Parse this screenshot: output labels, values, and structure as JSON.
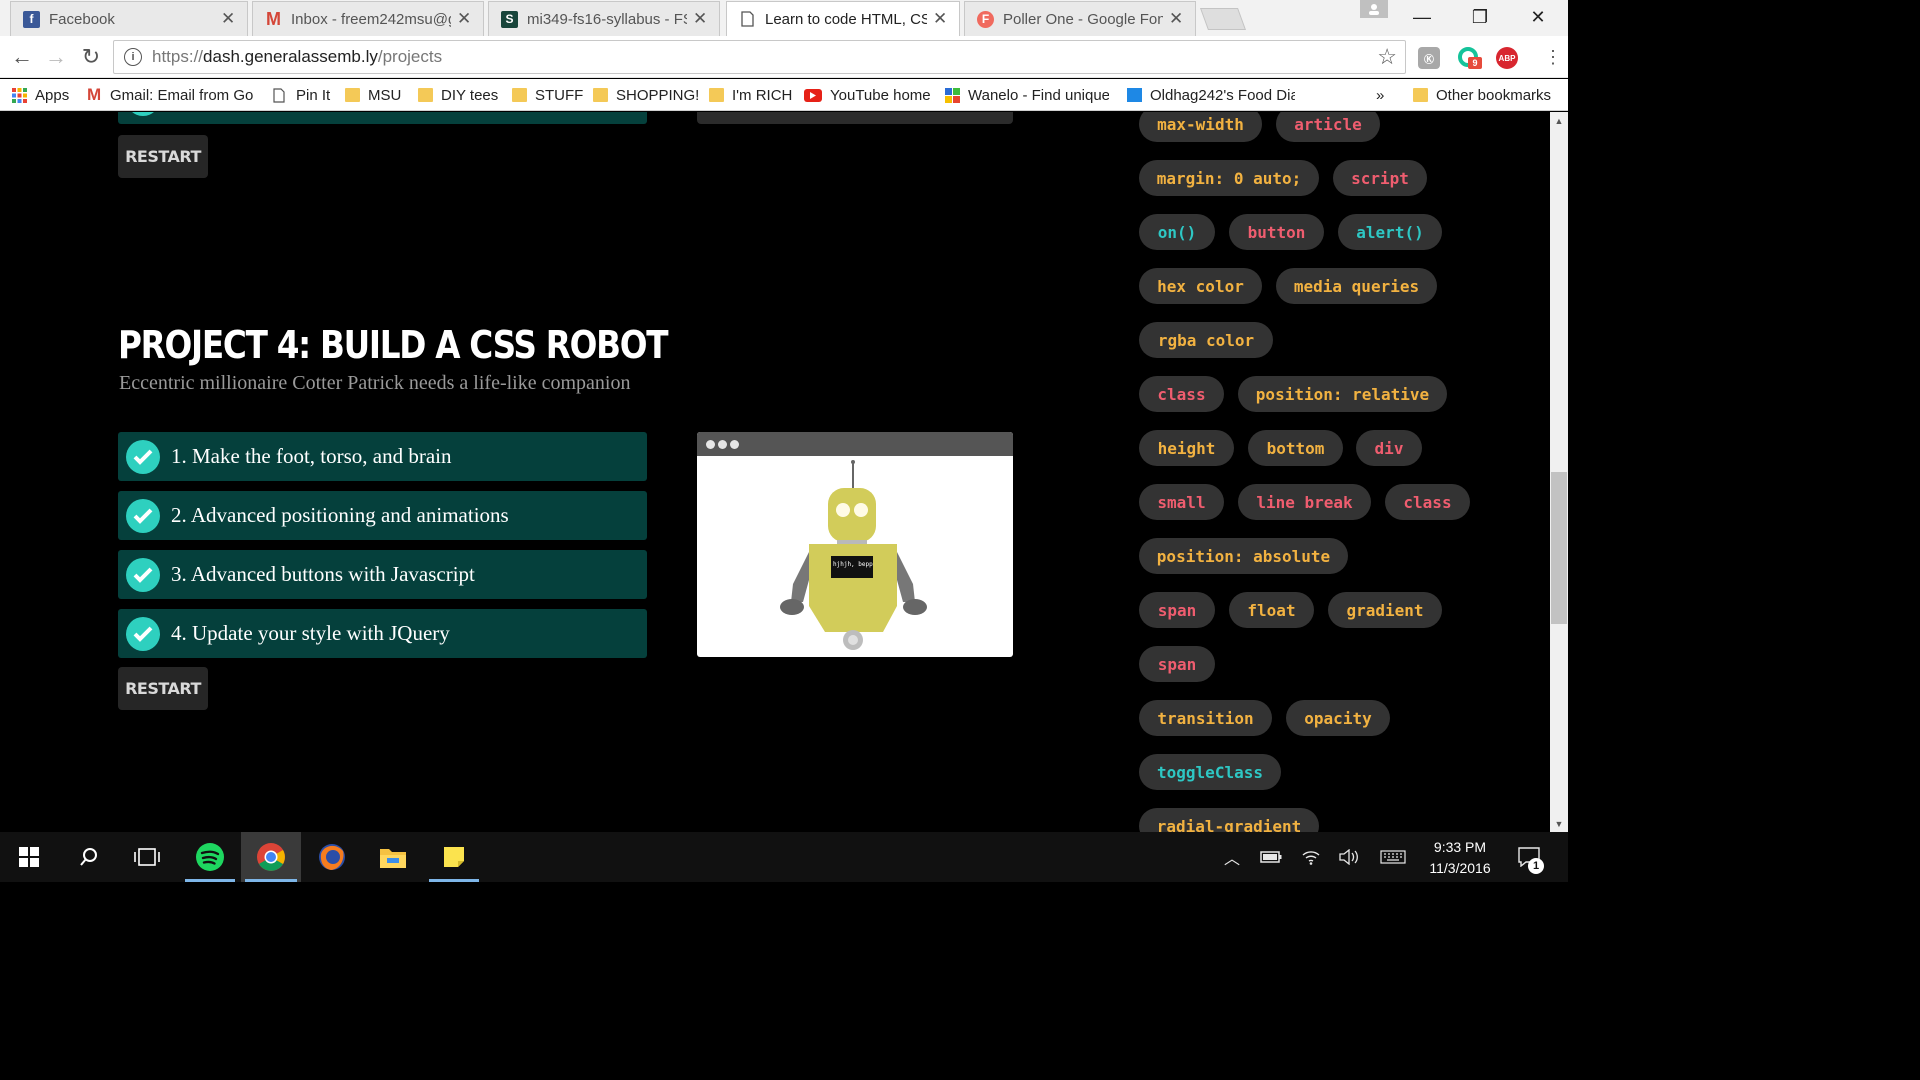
{
  "browser": {
    "tabs": [
      {
        "title": "Facebook",
        "active": false
      },
      {
        "title": "Inbox - freem242msu@g",
        "active": false
      },
      {
        "title": "mi349-fs16-syllabus - FS",
        "active": false
      },
      {
        "title": "Learn to code HTML, CSS",
        "active": true
      },
      {
        "title": "Poller One - Google Font",
        "active": false
      }
    ],
    "url_prefix": "https://",
    "url_domain": "dash.generalassemb.ly",
    "url_path": "/projects",
    "extensions": [
      "hackernews-extension",
      "grammarly-extension",
      "adblock-plus"
    ],
    "ext_badge": "9",
    "abp_label": "ABP",
    "bookmarks": [
      {
        "label": "Apps",
        "icon": "apps-grid-icon"
      },
      {
        "label": "Gmail: Email from Goo",
        "icon": "gmail-icon"
      },
      {
        "label": "Pin It",
        "icon": "page-icon"
      },
      {
        "label": "MSU",
        "icon": "folder-icon"
      },
      {
        "label": "DIY tees",
        "icon": "folder-icon"
      },
      {
        "label": "STUFF",
        "icon": "folder-icon"
      },
      {
        "label": "SHOPPING!",
        "icon": "folder-icon"
      },
      {
        "label": "I'm RICH",
        "icon": "folder-icon"
      },
      {
        "label": "YouTube home",
        "icon": "youtube-icon"
      },
      {
        "label": "Wanelo - Find unique",
        "icon": "wanelo-icon"
      },
      {
        "label": "Oldhag242's Food Dia",
        "icon": "blog-icon"
      }
    ],
    "bookmarks_overflow": "»",
    "other_bookmarks": "Other bookmarks"
  },
  "page": {
    "restart_label": "RESTART",
    "project_title": "PROJECT 4: BUILD A CSS ROBOT",
    "project_subtitle": "Eccentric millionaire Cotter Patrick needs a life-like companion",
    "steps": [
      "1. Make the foot, torso, and brain",
      "2. Advanced positioning and animations",
      "3. Advanced buttons with Javascript",
      "4. Update your style with JQuery"
    ],
    "robot_screen_text": "hjhjh, bepp",
    "tags": [
      {
        "label": "max-width",
        "color": "#f2b241"
      },
      {
        "label": "article",
        "color": "#ef5d6f"
      },
      {
        "label": "margin: 0 auto;",
        "color": "#f2b241"
      },
      {
        "label": "script",
        "color": "#ef5d6f"
      },
      {
        "label": "on()",
        "color": "#2ec7c4"
      },
      {
        "label": "button",
        "color": "#ef5d6f"
      },
      {
        "label": "alert()",
        "color": "#2ec7c4"
      },
      {
        "label": "hex color",
        "color": "#f2b241"
      },
      {
        "label": "media queries",
        "color": "#f2b241"
      },
      {
        "label": "rgba color",
        "color": "#f2b241"
      },
      {
        "label": "class",
        "color": "#ef5d6f"
      },
      {
        "label": "position: relative",
        "color": "#f2b241"
      },
      {
        "label": "height",
        "color": "#f2b241"
      },
      {
        "label": "bottom",
        "color": "#f2b241"
      },
      {
        "label": "div",
        "color": "#ef5d6f"
      },
      {
        "label": "small",
        "color": "#ef5d6f"
      },
      {
        "label": "line break",
        "color": "#ef5d6f"
      },
      {
        "label": "class",
        "color": "#ef5d6f"
      },
      {
        "label": "position: absolute",
        "color": "#f2b241"
      },
      {
        "label": "span",
        "color": "#ef5d6f"
      },
      {
        "label": "float",
        "color": "#f2b241"
      },
      {
        "label": "gradient",
        "color": "#f2b241"
      },
      {
        "label": "span",
        "color": "#ef5d6f"
      },
      {
        "label": "transition",
        "color": "#f2b241"
      },
      {
        "label": "opacity",
        "color": "#f2b241"
      },
      {
        "label": "toggleClass",
        "color": "#2ec7c4"
      },
      {
        "label": "radial-gradient",
        "color": "#f2b241"
      }
    ]
  },
  "taskbar": {
    "apps": [
      "start-icon",
      "search-icon",
      "task-view-icon",
      "spotify-icon",
      "chrome-icon",
      "firefox-icon",
      "file-explorer-icon",
      "sticky-notes-icon"
    ],
    "time": "9:33 PM",
    "date": "11/3/2016",
    "notification_count": "1"
  }
}
